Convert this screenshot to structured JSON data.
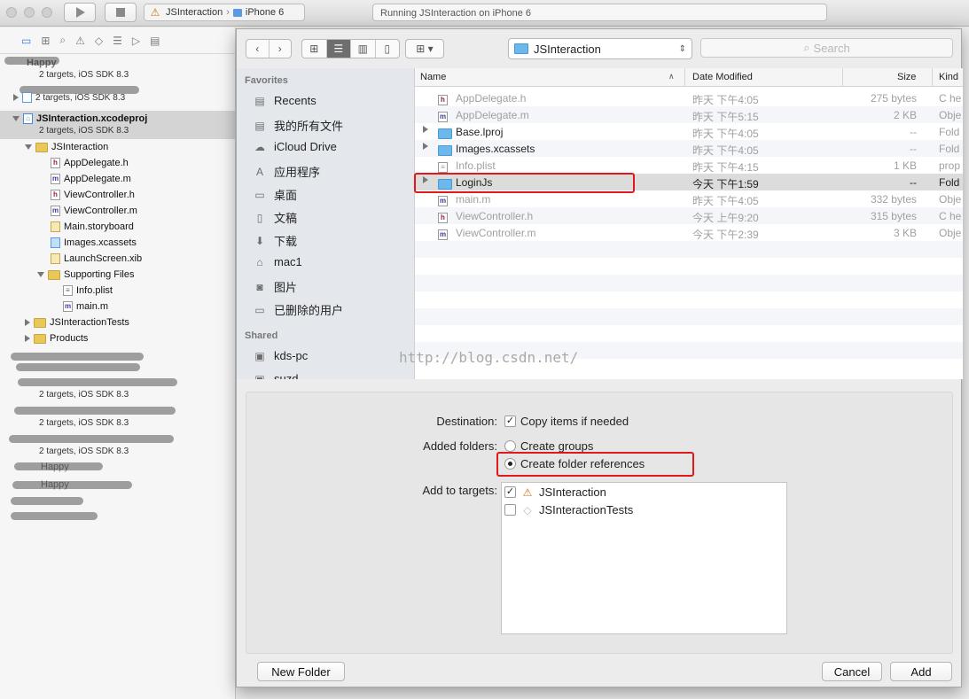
{
  "toolbar": {
    "scheme_target": "JSInteraction",
    "scheme_device": "iPhone 6",
    "activity": "Running JSInteraction on iPhone 6"
  },
  "navigator": {
    "projects": [
      {
        "name": "Happy",
        "sub": "2 targets, iOS SDK 8.3"
      },
      {
        "name": "",
        "sub": "2 targets, iOS SDK 8.3"
      },
      {
        "name": "JSInteraction.xcodeproj",
        "sub": "2 targets, iOS SDK 8.3"
      }
    ],
    "tree": [
      {
        "name": "JSInteraction",
        "icon": "folder-icon"
      },
      {
        "name": "AppDelegate.h",
        "icon": "header-file-icon"
      },
      {
        "name": "AppDelegate.m",
        "icon": "source-file-icon"
      },
      {
        "name": "ViewController.h",
        "icon": "header-file-icon"
      },
      {
        "name": "ViewController.m",
        "icon": "source-file-icon"
      },
      {
        "name": "Main.storyboard",
        "icon": "storyboard-icon"
      },
      {
        "name": "Images.xcassets",
        "icon": "asset-catalog-icon"
      },
      {
        "name": "LaunchScreen.xib",
        "icon": "xib-icon"
      },
      {
        "name": "Supporting Files",
        "icon": "folder-icon"
      },
      {
        "name": "Info.plist",
        "icon": "plist-icon"
      },
      {
        "name": "main.m",
        "icon": "source-file-icon"
      },
      {
        "name": "JSInteractionTests",
        "icon": "folder-icon"
      },
      {
        "name": "Products",
        "icon": "folder-icon"
      }
    ],
    "other_subs": [
      "2 targets, iOS SDK 8.3",
      "2 targets, iOS SDK 8.3",
      "2 targets, iOS SDK 8.3"
    ],
    "other_names": [
      "Happy",
      "Happy"
    ]
  },
  "dialog": {
    "path": "JSInteraction",
    "search_placeholder": "Search",
    "sidebar": {
      "favorites_header": "Favorites",
      "favorites": [
        "Recents",
        "我的所有文件",
        "iCloud Drive",
        "应用程序",
        "桌面",
        "文稿",
        "下载",
        "mac1",
        "图片",
        "已删除的用户"
      ],
      "shared_header": "Shared",
      "shared": [
        "kds-pc",
        "suzd"
      ]
    },
    "columns": {
      "name": "Name",
      "date": "Date Modified",
      "size": "Size",
      "kind": "Kind"
    },
    "files": [
      {
        "name": "AppDelegate.h",
        "date": "昨天 下午4:05",
        "size": "275 bytes",
        "kind": "C he"
      },
      {
        "name": "AppDelegate.m",
        "date": "昨天 下午5:15",
        "size": "2 KB",
        "kind": "Obje"
      },
      {
        "name": "Base.lproj",
        "date": "昨天 下午4:05",
        "size": "--",
        "kind": "Fold"
      },
      {
        "name": "Images.xcassets",
        "date": "昨天 下午4:05",
        "size": "--",
        "kind": "Fold"
      },
      {
        "name": "Info.plist",
        "date": "昨天 下午4:15",
        "size": "1 KB",
        "kind": "prop"
      },
      {
        "name": "LoginJs",
        "date": "今天 下午1:59",
        "size": "--",
        "kind": "Fold"
      },
      {
        "name": "main.m",
        "date": "昨天 下午4:05",
        "size": "332 bytes",
        "kind": "Obje"
      },
      {
        "name": "ViewController.h",
        "date": "今天 上午9:20",
        "size": "315 bytes",
        "kind": "C he"
      },
      {
        "name": "ViewController.m",
        "date": "今天 下午2:39",
        "size": "3 KB",
        "kind": "Obje"
      }
    ],
    "options": {
      "destination_label": "Destination:",
      "copy_items": "Copy items if needed",
      "copy_checked": true,
      "added_folders_label": "Added folders:",
      "create_groups": "Create groups",
      "create_folder_refs": "Create folder references",
      "selected_folder_option": "Create folder references",
      "add_to_targets_label": "Add to targets:",
      "targets": [
        {
          "name": "JSInteraction",
          "checked": true
        },
        {
          "name": "JSInteractionTests",
          "checked": false
        }
      ]
    },
    "buttons": {
      "new_folder": "New Folder",
      "cancel": "Cancel",
      "add": "Add"
    }
  },
  "watermark": "http://blog.csdn.net/",
  "colors": {
    "highlight_box": "#e0191d",
    "selected_row": "#dcdcdc",
    "accent": "#2f7fe8"
  }
}
